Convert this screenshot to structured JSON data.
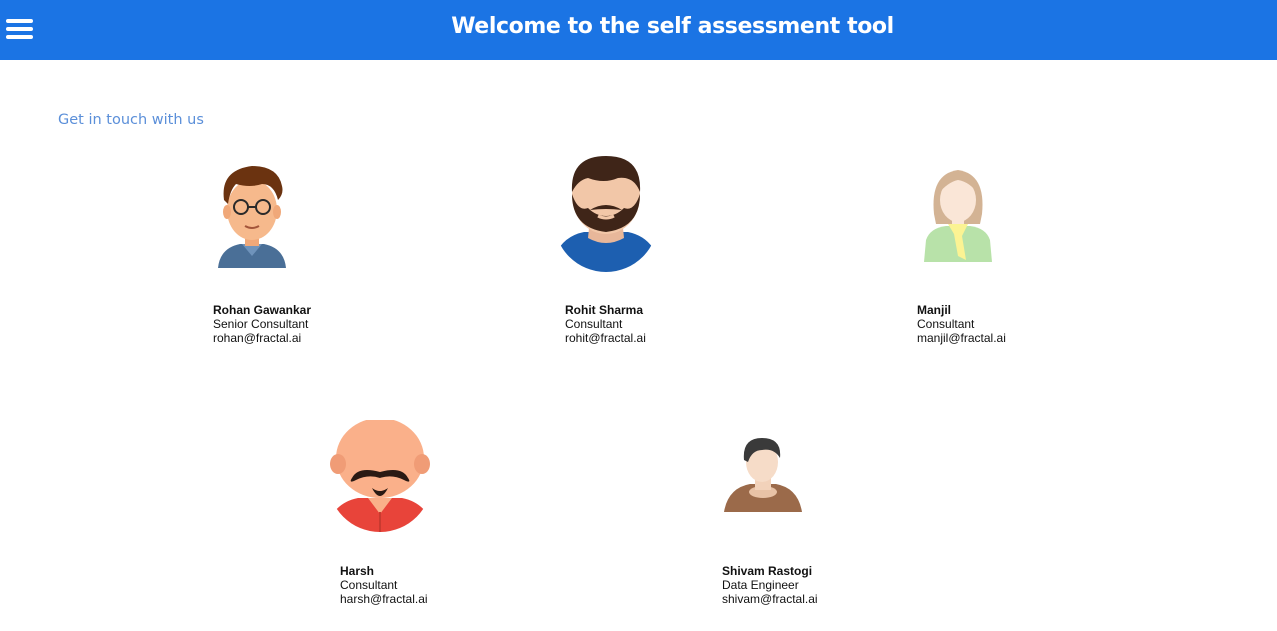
{
  "header": {
    "title": "Welcome to the self assessment tool",
    "menu_icon": "hamburger-menu-icon",
    "background_color": "#1b74e4"
  },
  "contact": {
    "heading": "Get in touch with us",
    "heading_color": "#5b8fd9",
    "people": [
      {
        "name": "Rohan Gawankar",
        "role": "Senior Consultant",
        "email": "rohan@fractal.ai",
        "avatar": "man-with-glasses-avatar-icon"
      },
      {
        "name": "Rohit Sharma",
        "role": "Consultant",
        "email": "rohit@fractal.ai",
        "avatar": "bearded-man-avatar-icon"
      },
      {
        "name": "Manjil",
        "role": "Consultant",
        "email": "manjil@fractal.ai",
        "avatar": "woman-avatar-icon"
      },
      {
        "name": "Harsh",
        "role": "Consultant",
        "email": "harsh@fractal.ai",
        "avatar": "mustache-man-avatar-icon"
      },
      {
        "name": "Shivam Rastogi",
        "role": "Data Engineer",
        "email": "shivam@fractal.ai",
        "avatar": "young-man-avatar-icon"
      }
    ]
  }
}
